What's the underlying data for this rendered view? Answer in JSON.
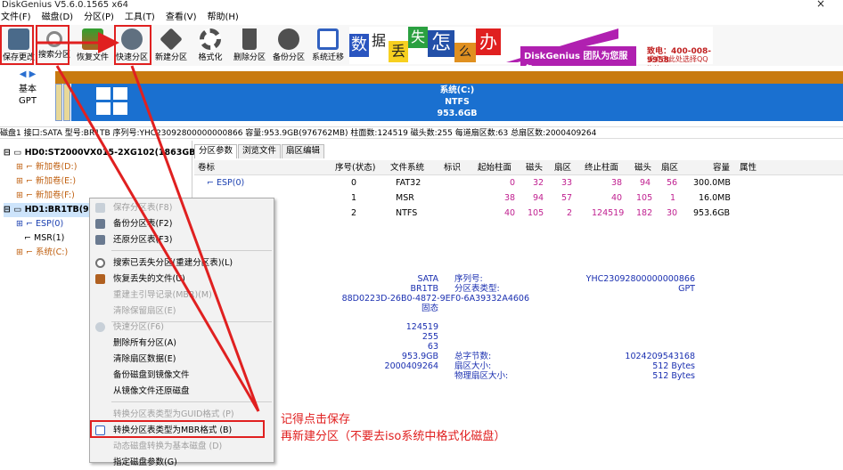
{
  "window": {
    "title": "DiskGenius V5.6.0.1565 x64",
    "close_glyph": "×"
  },
  "menu": [
    "文件(F)",
    "磁盘(D)",
    "分区(P)",
    "工具(T)",
    "查看(V)",
    "帮助(H)"
  ],
  "toolbar": {
    "buttons": [
      {
        "label": "保存更改",
        "icon": "save-icon",
        "color": "#4a6a8a"
      },
      {
        "label": "搜索分区",
        "icon": "search-icon",
        "color": "#888888"
      },
      {
        "label": "恢复文件",
        "icon": "recover-icon",
        "color": "#b06020"
      },
      {
        "label": "快速分区",
        "icon": "quick-partition-icon",
        "color": "#607080"
      },
      {
        "label": "新建分区",
        "icon": "new-partition-icon",
        "color": "#505050"
      },
      {
        "label": "格式化",
        "icon": "format-icon",
        "color": "#505050"
      },
      {
        "label": "删除分区",
        "icon": "delete-icon",
        "color": "#505050"
      },
      {
        "label": "备份分区",
        "icon": "backup-icon",
        "color": "#505050"
      },
      {
        "label": "系统迁移",
        "icon": "migrate-icon",
        "color": "#3060c0"
      }
    ]
  },
  "banner": {
    "chars": [
      "数",
      "据",
      "丢",
      "失",
      "怎",
      "么",
      "办"
    ],
    "tagline": "DiskGenius 团队为您服务",
    "phone": "致电：400-008-9958",
    "qq": "或点击此处选择QQ咨询"
  },
  "diskbar": {
    "nav": "◀ ▶",
    "disk_type": "基本",
    "table_type": "GPT",
    "partition_name": "系统(C:)",
    "partition_fs": "NTFS",
    "partition_size": "953.6GB"
  },
  "diskinfo": "磁盘1 接口:SATA  型号:BR1TB  序列号:YHC23092800000000866  容量:953.9GB(976762MB)  柱面数:124519  磁头数:255  每道扇区数:63  总扇区数:2000409264",
  "tree": {
    "hd0": "HD0:ST2000VX015-2XG102(1863GB)",
    "hd0_parts": [
      "新加卷(D:)",
      "新加卷(E:)",
      "新加卷(F:)"
    ],
    "hd1": "HD1:BR1TB(95",
    "hd1_parts": [
      "ESP(0)",
      "MSR(1)",
      "系统(C:)"
    ]
  },
  "tabs": [
    "分区参数",
    "浏览文件",
    "扇区编辑"
  ],
  "table": {
    "headers": [
      "卷标",
      "序号(状态)",
      "文件系统",
      "标识",
      "起始柱面",
      "磁头",
      "扇区",
      "终止柱面",
      "磁头",
      "扇区",
      "容量",
      "属性"
    ],
    "rows": [
      [
        "ESP(0)",
        "0",
        "FAT32",
        "",
        "0",
        "32",
        "33",
        "38",
        "94",
        "56",
        "300.0MB",
        ""
      ],
      [
        "",
        "1",
        "MSR",
        "",
        "38",
        "94",
        "57",
        "40",
        "105",
        "1",
        "16.0MB",
        ""
      ],
      [
        "",
        "2",
        "NTFS",
        "",
        "40",
        "105",
        "2",
        "124519",
        "182",
        "30",
        "953.6GB",
        ""
      ]
    ]
  },
  "details": {
    "iface": "SATA",
    "model": "BR1TB",
    "guid": "88D0223D-26B0-4872-9EF0-6A39332A4606",
    "state": "固态",
    "serial_label": "序列号:",
    "serial": "YHC23092800000000866",
    "pt_label": "分区表类型:",
    "pt": "GPT",
    "cyl": "124519",
    "heads": "255",
    "spt": "63",
    "cap": "953.9GB",
    "total_sectors": "2000409264",
    "bytes_label": "总字节数:",
    "bytes": "1024209543168",
    "sector_label": "扇区大小:",
    "sector": "512 Bytes",
    "phys_label": "物理扇区大小:",
    "phys": "512 Bytes"
  },
  "context_menu": [
    {
      "label": "保存分区表(F8)",
      "disabled": true
    },
    {
      "label": "备份分区表(F2)",
      "disabled": false
    },
    {
      "label": "还原分区表(F3)",
      "disabled": false
    },
    {
      "label": "搜索已丢失分区(重建分区表)(L)",
      "disabled": false
    },
    {
      "label": "恢复丢失的文件(U)",
      "disabled": false
    },
    {
      "label": "重建主引导记录(MBR)(M)",
      "disabled": true
    },
    {
      "label": "清除保留扇区(E)",
      "disabled": true
    },
    {
      "label": "快速分区(F6)",
      "disabled": true
    },
    {
      "label": "删除所有分区(A)",
      "disabled": false
    },
    {
      "label": "清除扇区数据(E)",
      "disabled": false
    },
    {
      "label": "备份磁盘到镜像文件",
      "disabled": false
    },
    {
      "label": "从镜像文件还原磁盘",
      "disabled": false
    },
    {
      "label": "转换分区表类型为GUID格式 (P)",
      "disabled": true
    },
    {
      "label": "转换分区表类型为MBR格式 (B)",
      "disabled": false
    },
    {
      "label": "动态磁盘转换为基本磁盘 (D)",
      "disabled": true
    },
    {
      "label": "指定磁盘参数(G)",
      "disabled": false
    }
  ],
  "annotation": {
    "line1": "记得点击保存",
    "line2": "再新建分区（不要去iso系统中格式化磁盘）"
  },
  "colors": {
    "accent_red": "#e02020",
    "partition_blue": "#1a70d0",
    "disk_orange": "#c87a10"
  }
}
